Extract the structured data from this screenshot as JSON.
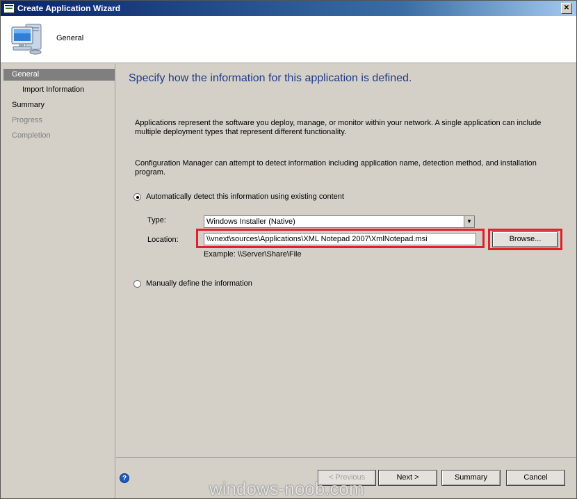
{
  "window": {
    "title": "Create Application Wizard",
    "close_glyph": "✕"
  },
  "header": {
    "title": "General",
    "icon": "computer-icon"
  },
  "nav": {
    "items": [
      {
        "label": "General",
        "state": "active"
      },
      {
        "label": "Import Information",
        "state": "sub"
      },
      {
        "label": "Summary",
        "state": "normal"
      },
      {
        "label": "Progress",
        "state": "disabled"
      },
      {
        "label": "Completion",
        "state": "disabled"
      }
    ]
  },
  "content": {
    "heading": "Specify how the information for this application is defined.",
    "paragraph1": "Applications represent the software you deploy, manage, or monitor within your network. A single application can include multiple deployment types that represent different functionality.",
    "paragraph2": "Configuration Manager can attempt to detect information including application name, detection method, and installation program.",
    "auto_detect_label": "Automatically detect this information using existing content",
    "auto_detect_selected": true,
    "type_label": "Type:",
    "type_value": "Windows Installer (Native)",
    "location_label": "Location:",
    "location_value": "\\\\vnext\\sources\\Applications\\XML Notepad 2007\\XmlNotepad.msi",
    "browse_label": "Browse...",
    "example_text": "Example: \\\\Server\\Share\\File",
    "manual_label": "Manually define the information",
    "highlight_color": "#e0202a"
  },
  "footer": {
    "help_glyph": "?",
    "previous_label": "< Previous",
    "next_label": "Next >",
    "summary_label": "Summary",
    "cancel_label": "Cancel"
  },
  "watermark": "windows-noob.com"
}
